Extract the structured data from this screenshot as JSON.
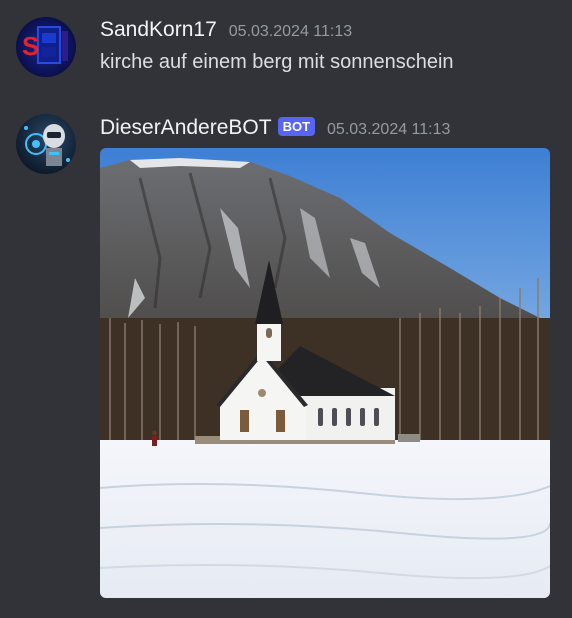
{
  "messages": [
    {
      "username": "SandKorn17",
      "timestamp": "05.03.2024 11:13",
      "text": "kirche auf einem berg mit sonnenschein",
      "avatar_icon": "user-avatar"
    },
    {
      "username": "DieserAndereBOT",
      "bot_tag": "BOT",
      "timestamp": "05.03.2024 11:13",
      "avatar_icon": "bot-avatar",
      "attachment": {
        "type": "image",
        "alt": "generated image"
      }
    }
  ],
  "colors": {
    "background": "#313338",
    "username": "#f2f3f5",
    "timestamp": "#949ba4",
    "message_text": "#dbdee1",
    "bot_tag": "#5865f2"
  }
}
